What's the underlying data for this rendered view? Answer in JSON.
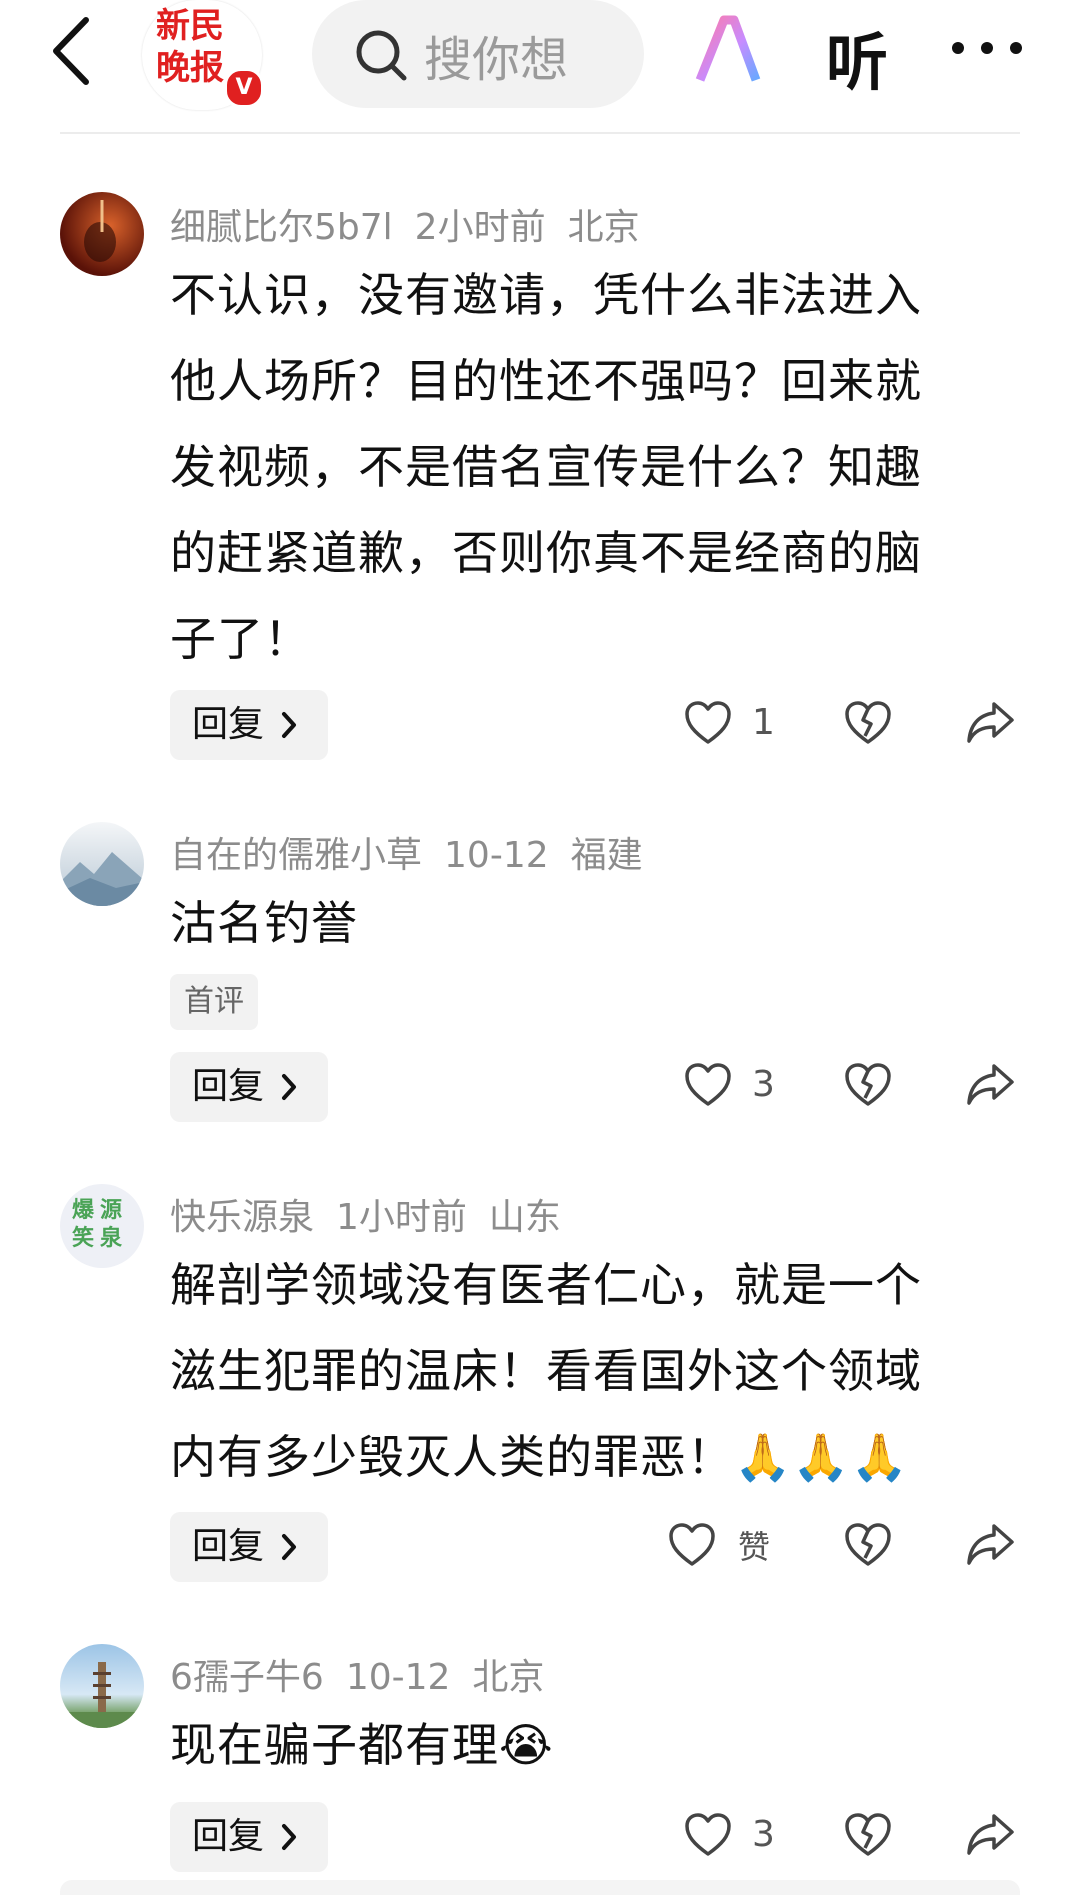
{
  "header": {
    "logo_line1": "新民",
    "logo_line2": "晚报",
    "logo_badge": "V",
    "search_placeholder": "搜你想",
    "ai_label": "AI",
    "listen_label": "听",
    "icons": {
      "back": "back-arrow-icon",
      "search": "search-icon",
      "ai": "ai-icon",
      "more": "more-icon"
    }
  },
  "comments": [
    {
      "user": "细腻比尔5b7l",
      "time": "2小时前",
      "location": "北京",
      "text_lines": [
        "不认识，没有邀请，凭什么非法进入",
        "他人场所？目的性还不强吗？回来就",
        "发视频，不是借名宣传是什么？知趣",
        "的赶紧道歉，否则你真不是经商的脑",
        "子了！"
      ],
      "reply_label": "回复",
      "likes": "1",
      "avatar_color": "#7a1e10"
    },
    {
      "user": "自在的儒雅小草",
      "time": "10-12",
      "location": "福建",
      "text_lines": [
        "沽名钓誉"
      ],
      "tag": "首评",
      "reply_label": "回复",
      "likes": "3",
      "avatar_color": "#c9d6e0"
    },
    {
      "user": "快乐源泉",
      "time": "1小时前",
      "location": "山东",
      "text_lines": [
        "解剖学领域没有医者仁心，就是一个",
        "滋生犯罪的温床！看看国外这个领域",
        "内有多少毁灭人类的罪恶！🙏🙏🙏"
      ],
      "reply_label": "回复",
      "likes": "赞",
      "avatar_text": [
        "爆源",
        "笑泉"
      ],
      "avatar_color": "#eef0f6"
    },
    {
      "user": "6孺子牛6",
      "time": "10-12",
      "location": "北京",
      "text_lines": [
        "现在骗子都有理😭"
      ],
      "reply_label": "回复",
      "likes": "3",
      "avatar_color": "#9cc4e6"
    }
  ]
}
